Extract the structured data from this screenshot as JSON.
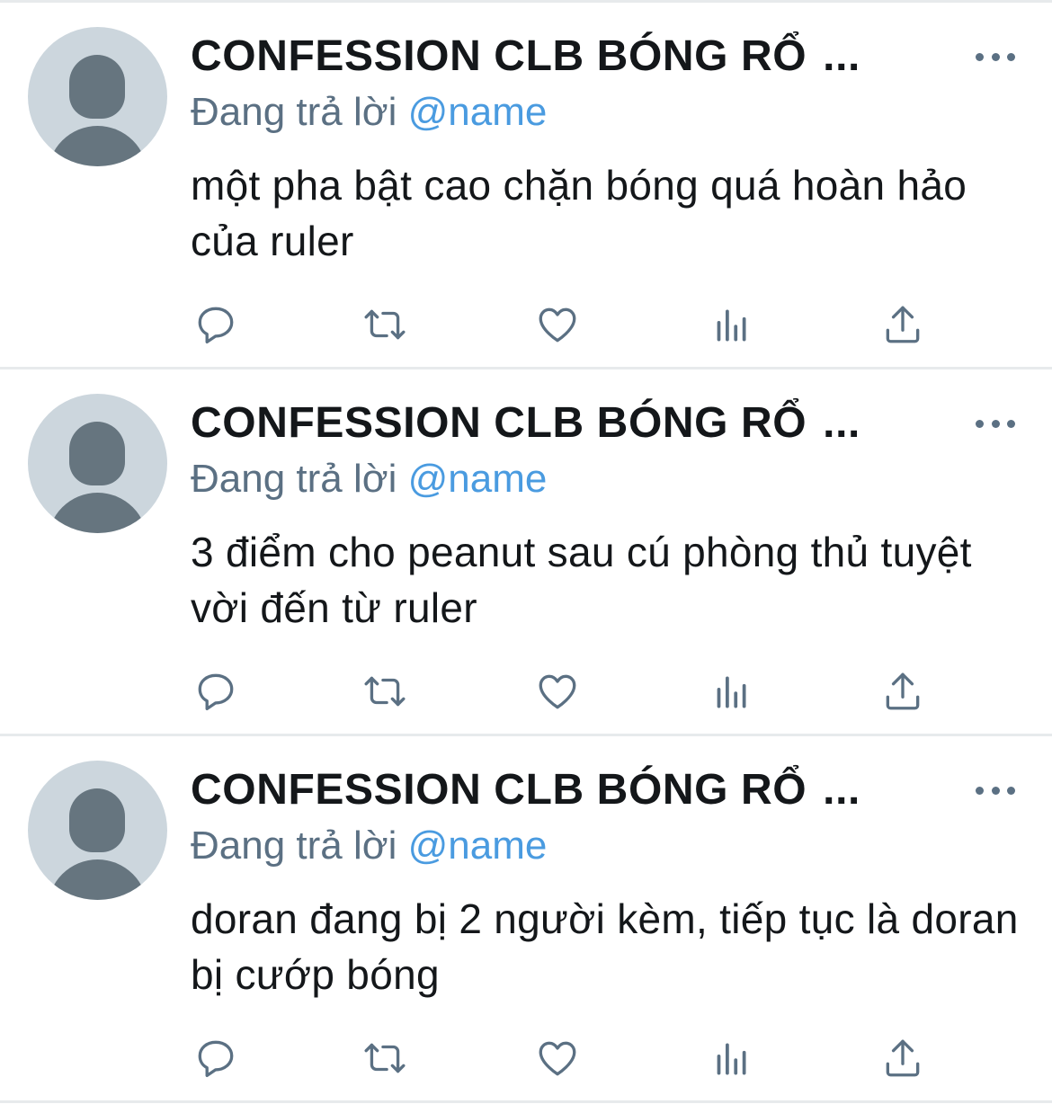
{
  "colors": {
    "accent": "#4a9be0",
    "muted": "#5b7083",
    "divider": "#e7eaec",
    "avatar_bg": "#ccd6dd",
    "avatar_fg": "#66757f"
  },
  "icons": {
    "more": "more-horizontal-icon",
    "reply": "reply-bubble-icon",
    "retweet": "retweet-icon",
    "like": "heart-icon",
    "analytics": "analytics-bars-icon",
    "share": "share-upload-icon"
  },
  "tweets": [
    {
      "author": "CONFESSION CLB BÓNG RỔ",
      "ellipsis": "...",
      "reply_prefix": "Đang trả lời",
      "reply_handle": "@name",
      "text": "một pha bật cao chặn bóng quá hoàn hảo của ruler"
    },
    {
      "author": "CONFESSION CLB BÓNG RỔ",
      "ellipsis": "...",
      "reply_prefix": "Đang trả lời",
      "reply_handle": "@name",
      "text": "3 điểm cho peanut sau cú phòng thủ tuyệt vời đến từ ruler"
    },
    {
      "author": "CONFESSION CLB BÓNG RỔ",
      "ellipsis": "...",
      "reply_prefix": "Đang trả lời",
      "reply_handle": "@name",
      "text": "doran đang bị 2 người kèm, tiếp tục là doran bị cướp bóng"
    }
  ]
}
